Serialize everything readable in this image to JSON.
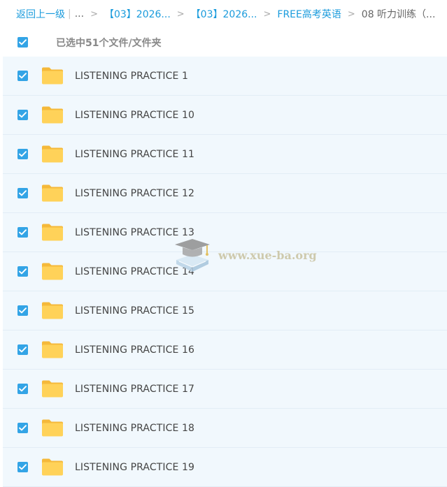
{
  "breadcrumb": {
    "back": "返回上一级",
    "bar": "|",
    "ellipsis": "...",
    "arrow": ">",
    "items": [
      "【03】2026...",
      "【03】2026...",
      "FREE高考英语"
    ],
    "current": "08 听力训练（..."
  },
  "selection": {
    "count_text": "已选中51个文件/文件夹",
    "all_checked": true
  },
  "files": [
    {
      "name": "LISTENING PRACTICE 1",
      "checked": true
    },
    {
      "name": "LISTENING PRACTICE 10",
      "checked": true
    },
    {
      "name": "LISTENING PRACTICE 11",
      "checked": true
    },
    {
      "name": "LISTENING PRACTICE 12",
      "checked": true
    },
    {
      "name": "LISTENING PRACTICE 13",
      "checked": true
    },
    {
      "name": "LISTENING PRACTICE 14",
      "checked": true
    },
    {
      "name": "LISTENING PRACTICE 15",
      "checked": true
    },
    {
      "name": "LISTENING PRACTICE 16",
      "checked": true
    },
    {
      "name": "LISTENING PRACTICE 17",
      "checked": true
    },
    {
      "name": "LISTENING PRACTICE 18",
      "checked": true
    },
    {
      "name": "LISTENING PRACTICE 19",
      "checked": true
    }
  ],
  "watermark": {
    "text": "www.xue-ba.org",
    "icon": "graduation-cap-book-icon"
  },
  "icons": {
    "checkbox": "checkmark-icon",
    "folder": "folder-icon"
  },
  "colors": {
    "accent": "#1a9bdc",
    "checkbox": "#33a4e6",
    "folder": "#ffd259",
    "row_bg": "#f1f8fd",
    "row_border": "#e2edf6",
    "text": "#444444",
    "muted": "#888888"
  }
}
